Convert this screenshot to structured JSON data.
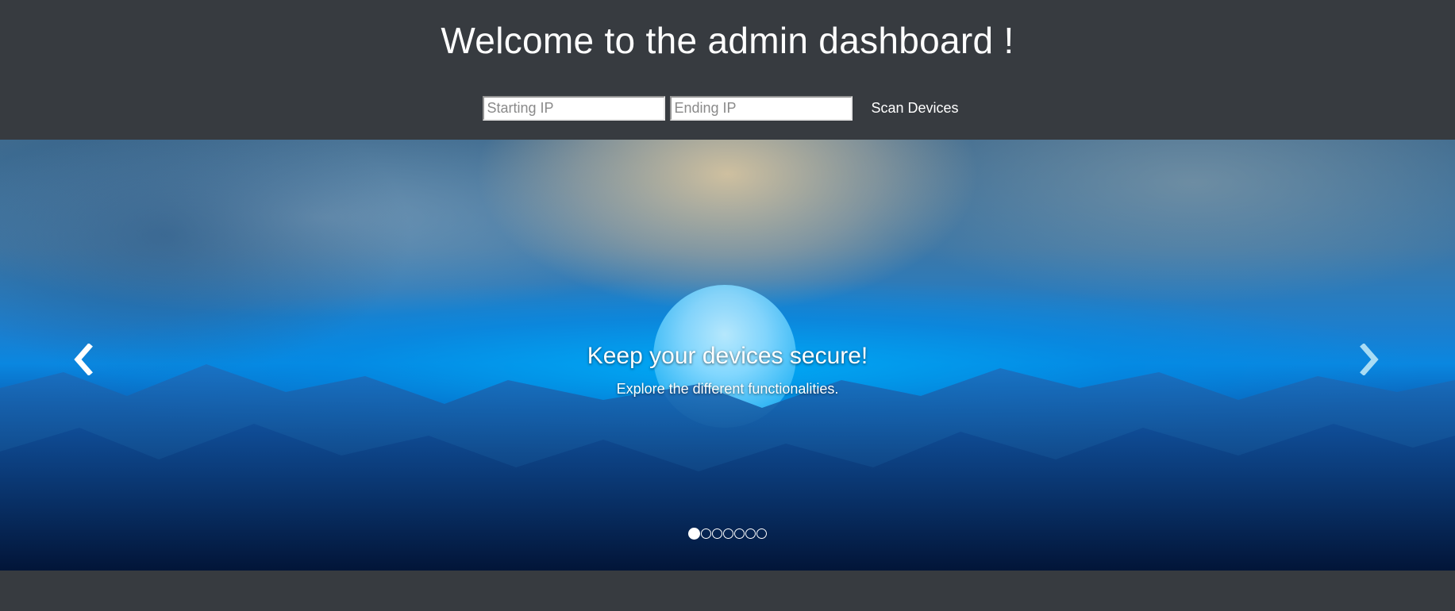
{
  "header": {
    "title": "Welcome to the admin dashboard !",
    "starting_ip_placeholder": "Starting IP",
    "ending_ip_placeholder": "Ending IP",
    "starting_ip_value": "",
    "ending_ip_value": "",
    "scan_label": "Scan Devices"
  },
  "carousel": {
    "caption_title": "Keep your devices secure!",
    "caption_text": "Explore the different functionalities.",
    "prev_icon": "chevron-left-icon",
    "next_icon": "chevron-right-icon",
    "slide_count": 7,
    "active_index": 0
  },
  "colors": {
    "page_background": "#373b40",
    "text": "#ffffff",
    "accent_blue": "#0a87e0"
  }
}
